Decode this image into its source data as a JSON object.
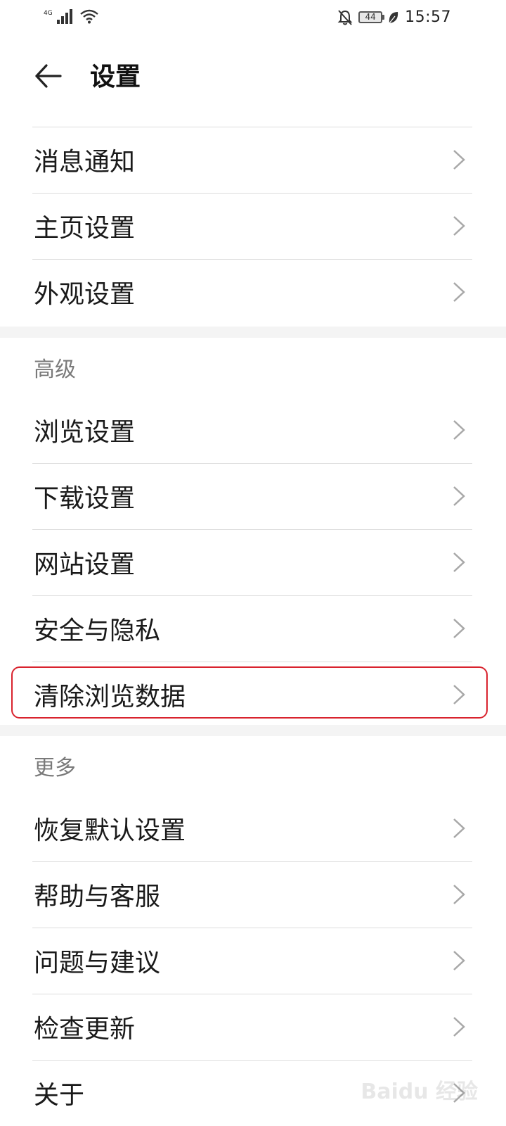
{
  "status_bar": {
    "network_type": "4G",
    "battery_level": "44",
    "time": "15:57"
  },
  "app_bar": {
    "title": "设置"
  },
  "groups": {
    "general": {
      "items": [
        {
          "label": "消息通知"
        },
        {
          "label": "主页设置"
        },
        {
          "label": "外观设置"
        }
      ]
    },
    "advanced": {
      "header": "高级",
      "items": [
        {
          "label": "浏览设置"
        },
        {
          "label": "下载设置"
        },
        {
          "label": "网站设置"
        },
        {
          "label": "安全与隐私"
        },
        {
          "label": "清除浏览数据"
        }
      ]
    },
    "more": {
      "header": "更多",
      "items": [
        {
          "label": "恢复默认设置"
        },
        {
          "label": "帮助与客服"
        },
        {
          "label": "问题与建议"
        },
        {
          "label": "检查更新"
        },
        {
          "label": "关于"
        }
      ]
    }
  },
  "colors": {
    "highlight": "#d9232e",
    "divider": "#dddddd",
    "section_header": "#7a7a7a"
  },
  "watermark": "Baidu 经验"
}
